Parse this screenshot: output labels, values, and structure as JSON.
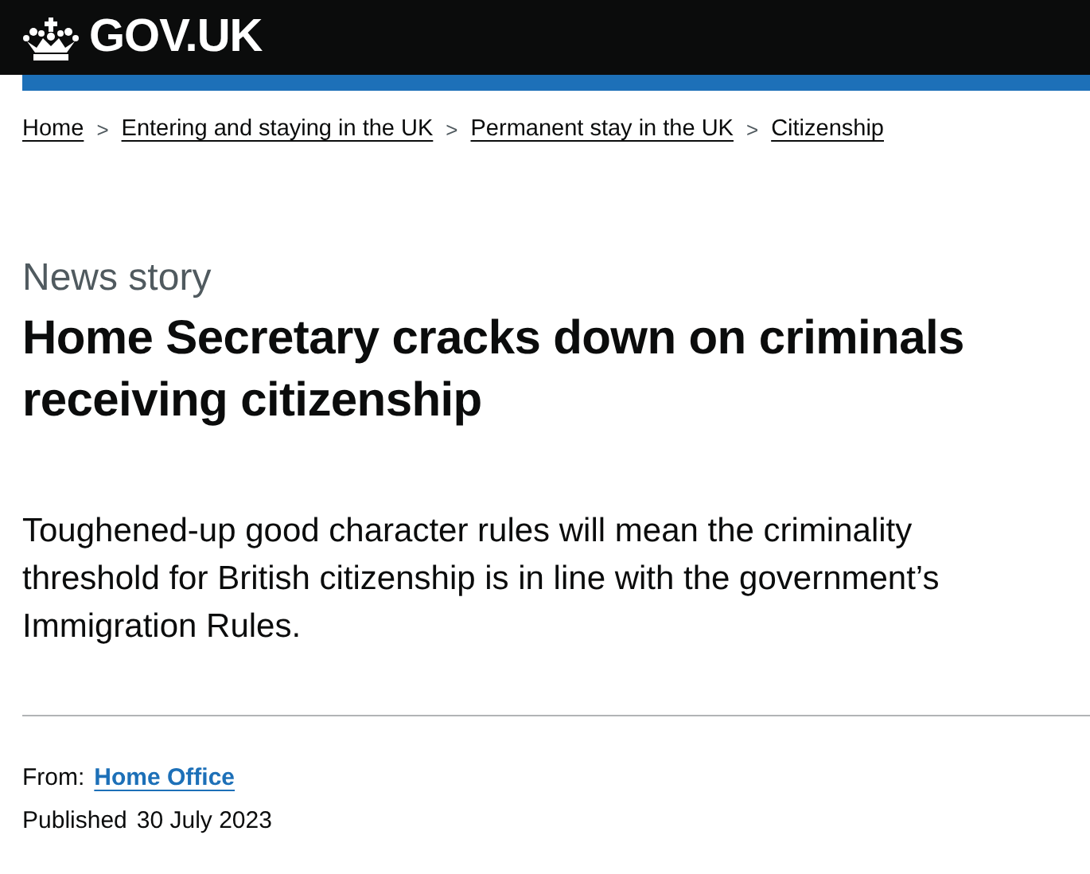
{
  "header": {
    "logo_text": "GOV.UK"
  },
  "breadcrumbs": [
    "Home",
    "Entering and staying in the UK",
    "Permanent stay in the UK",
    "Citizenship"
  ],
  "breadcrumb_separator": ">",
  "article": {
    "type": "News story",
    "title": "Home Secretary cracks down on criminals receiving citizenship",
    "lead": "Toughened-up good character rules will mean the criminality threshold for British citizenship is in line with the government’s Immigration Rules."
  },
  "metadata": {
    "from_label": "From:",
    "from_link": "Home Office",
    "published_label": "Published",
    "published_date": "30 July 2023"
  }
}
